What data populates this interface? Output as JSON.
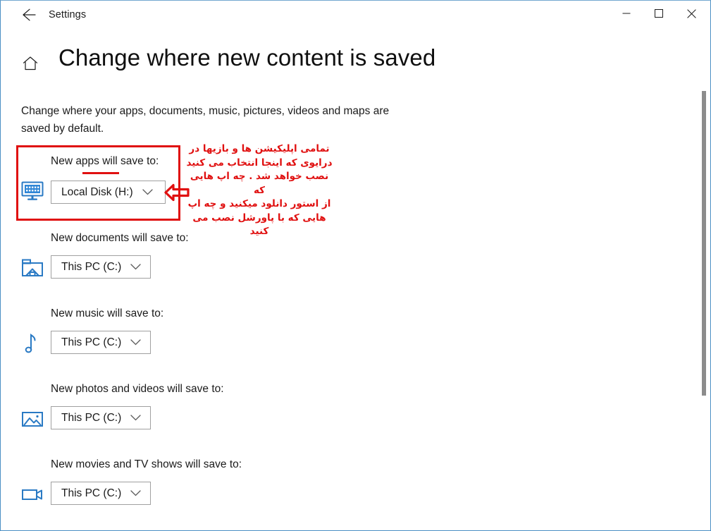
{
  "window": {
    "app_title": "Settings",
    "back_icon": "back-arrow-icon",
    "minimize_label": "—",
    "maximize_label": "□",
    "close_label": "✕"
  },
  "header": {
    "home_icon": "home-icon",
    "page_title": "Change where new content is saved"
  },
  "intro": "Change where your apps, documents, music, pictures, videos and maps are saved by default.",
  "settings": [
    {
      "key": "apps",
      "icon": "display-apps-icon",
      "label": "New apps will save to:",
      "value": "Local Disk (H:)"
    },
    {
      "key": "documents",
      "icon": "documents-folder-icon",
      "label": "New documents will save to:",
      "value": "This PC (C:)"
    },
    {
      "key": "music",
      "icon": "music-note-icon",
      "label": "New music will save to:",
      "value": "This PC (C:)"
    },
    {
      "key": "photos",
      "icon": "picture-icon",
      "label": "New photos and videos will save to:",
      "value": "This PC (C:)"
    },
    {
      "key": "movies",
      "icon": "video-camera-icon",
      "label": "New movies and TV shows will save to:",
      "value": "This PC (C:)"
    }
  ],
  "annotation": {
    "color": "#e01010",
    "arrow_icon": "left-arrow-callout-icon",
    "note_text": "تمامی اپلیکیشن ها و بازیها در\nدرایوی که اینجا انتخاب می کنید\nنصب خواهد شد . چه اپ هایی که\nاز استور دانلود میکنید و چه اپ\nهایی که با پاورشل نصب می کنید"
  },
  "colors": {
    "window_border": "#4a8fc4",
    "icon_blue": "#2a7ac4",
    "text": "#1b1b1b",
    "combo_border": "#a0a0a0",
    "scrollbar_thumb": "#8c8c8c"
  }
}
